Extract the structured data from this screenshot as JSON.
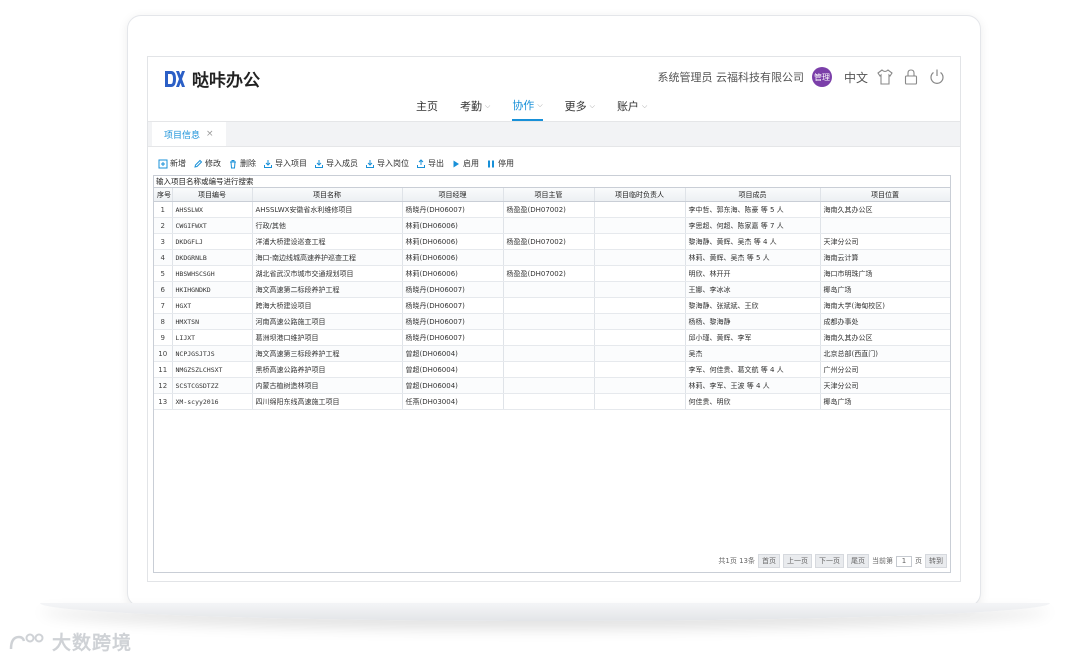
{
  "brand": {
    "name": "哒咔办公"
  },
  "header": {
    "user": "系统管理员 云福科技有限公司",
    "badge": "管理",
    "lang": "中文"
  },
  "nav": [
    {
      "label": "主页",
      "caret": false,
      "active": false
    },
    {
      "label": "考勤",
      "caret": true,
      "active": false
    },
    {
      "label": "协作",
      "caret": true,
      "active": true
    },
    {
      "label": "更多",
      "caret": true,
      "active": false
    },
    {
      "label": "账户",
      "caret": true,
      "active": false
    }
  ],
  "tab": {
    "label": "项目信息",
    "close": "×"
  },
  "toolbar": [
    {
      "label": "新增",
      "icon": "add-icon"
    },
    {
      "label": "修改",
      "icon": "edit-icon"
    },
    {
      "label": "删除",
      "icon": "trash-icon"
    },
    {
      "label": "导入项目",
      "icon": "import-icon"
    },
    {
      "label": "导入成员",
      "icon": "import-icon"
    },
    {
      "label": "导入岗位",
      "icon": "import-icon"
    },
    {
      "label": "导出",
      "icon": "export-icon"
    },
    {
      "label": "启用",
      "icon": "play-icon"
    },
    {
      "label": "停用",
      "icon": "pause-icon"
    }
  ],
  "grid": {
    "search_label": "输入项目名称或编号进行搜索",
    "columns": [
      "序号",
      "项目编号",
      "项目名称",
      "项目经理",
      "项目主管",
      "项目临时负责人",
      "项目成员",
      "项目位置"
    ],
    "rows": [
      [
        "1",
        "AHSSLWX",
        "AHSSLWX安徽省水利维修项目",
        "杨晓丹(DH06007)",
        "杨盈盈(DH07002)",
        "",
        "李中哲、郭东海、陈豪 等 5 人",
        "海南久其办公区"
      ],
      [
        "2",
        "CWGIFWXT",
        "行政/其他",
        "林莉(DH06006)",
        "",
        "",
        "李思超、何超、陈家嘉 等 7 人",
        ""
      ],
      [
        "3",
        "DKDGFLJ",
        "洋浦大桥建设巡查工程",
        "林莉(DH06006)",
        "杨盈盈(DH07002)",
        "",
        "黎海静、黄辉、吴杰 等 4 人",
        "天津分公司"
      ],
      [
        "4",
        "DKDGRNLB",
        "海口-南边线城高速养护巡查工程",
        "林莉(DH06006)",
        "",
        "",
        "林莉、黄辉、吴杰 等 5 人",
        "海南云计算"
      ],
      [
        "5",
        "HBSWHSCSGH",
        "湖北省武汉市城市交通规划项目",
        "林莉(DH06006)",
        "杨盈盈(DH07002)",
        "",
        "明欣、林开开",
        "海口市明珠广场"
      ],
      [
        "6",
        "HKIHGNDKD",
        "海文高速第二标段养护工程",
        "杨晓丹(DH06007)",
        "",
        "",
        "王娜、李冰冰",
        "椰岛广场"
      ],
      [
        "7",
        "HGXT",
        "跨海大桥建设项目",
        "杨晓丹(DH06007)",
        "",
        "",
        "黎海静、张斌斌、王欣",
        "海南大学(海甸校区)"
      ],
      [
        "8",
        "HMXTSN",
        "河南高速公路施工项目",
        "杨晓丹(DH06007)",
        "",
        "",
        "杨杨、黎海静",
        "成都办事处"
      ],
      [
        "9",
        "LIJXT",
        "葛洲坝港口维护项目",
        "杨晓丹(DH06007)",
        "",
        "",
        "邱小瑾、黄辉、李军",
        "海南久其办公区"
      ],
      [
        "10",
        "NCPJGSJTJS",
        "海文高速第三标段养护工程",
        "曾超(DH06004)",
        "",
        "",
        "吴杰",
        "北京总部(西直门)"
      ],
      [
        "11",
        "NMGZSZLCHSXT",
        "黑桥高速公路养护项目",
        "曾超(DH06004)",
        "",
        "",
        "李军、何佳贵、葛文航 等 4 人",
        "广州分公司"
      ],
      [
        "12",
        "SCSTCGSDTZZ",
        "内蒙古植树造林项目",
        "曾超(DH06004)",
        "",
        "",
        "林莉、李军、王波 等 4 人",
        "天津分公司"
      ],
      [
        "13",
        "XM-scyy2016",
        "四川绵阳东线高速施工项目",
        "任燕(DH03004)",
        "",
        "",
        "何佳贵、明欣",
        "椰岛广场"
      ]
    ]
  },
  "pager": {
    "summary": "共1页 13条",
    "first": "首页",
    "prev": "上一页",
    "next": "下一页",
    "last": "尾页",
    "current_prefix": "当前第",
    "current_page": "1",
    "current_suffix": "页",
    "go": "转到"
  },
  "watermark": "大数跨境",
  "colors": {
    "accent": "#1890d8",
    "brand": "#2b5fc6",
    "admin_badge": "#7b3fa9"
  }
}
